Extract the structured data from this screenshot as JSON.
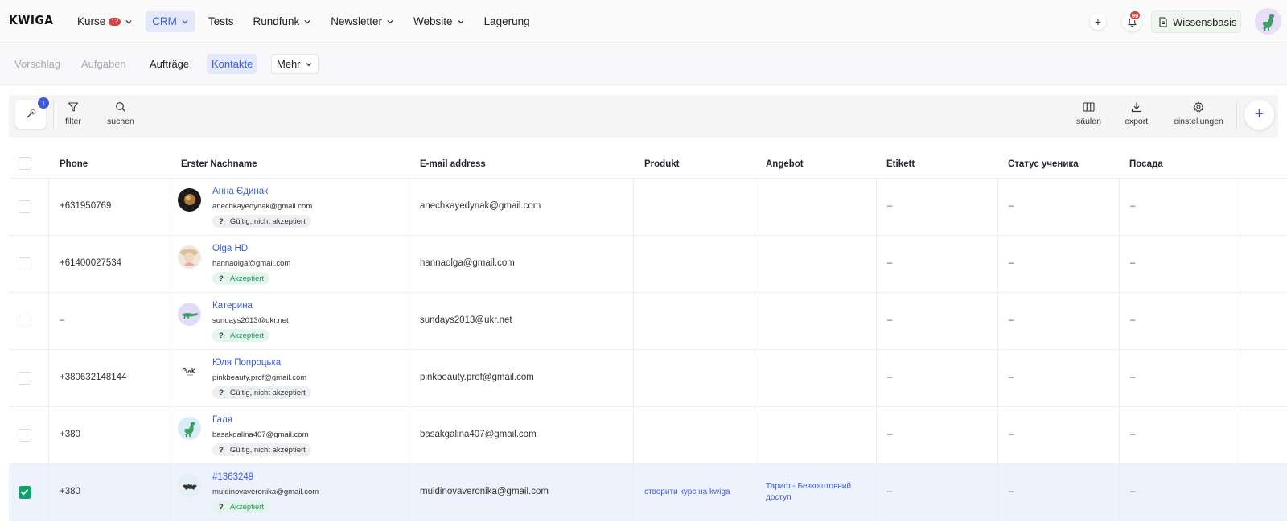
{
  "app": {
    "logo": "KWIGA"
  },
  "nav": {
    "items": [
      {
        "label": "Kurse",
        "badge": "12",
        "dropdown": true,
        "active": false
      },
      {
        "label": "CRM",
        "dropdown": true,
        "active": true
      },
      {
        "label": "Tests",
        "dropdown": false,
        "active": false
      },
      {
        "label": "Rundfunk",
        "dropdown": true,
        "active": false
      },
      {
        "label": "Newsletter",
        "dropdown": true,
        "active": false
      },
      {
        "label": "Website",
        "dropdown": true,
        "active": false
      },
      {
        "label": "Lagerung",
        "dropdown": false,
        "active": false
      }
    ]
  },
  "header_right": {
    "add_icon": "plus-icon",
    "notifications_count": "99",
    "knowledge_base_label": "Wissensbasis"
  },
  "subtabs": {
    "vorschlag": "Vorschlag",
    "aufgaben": "Aufgaben",
    "auftraege": "Aufträge",
    "kontakte": "Kontakte",
    "mehr": "Mehr"
  },
  "toolbar": {
    "magic_badge": "1",
    "filter": "filter",
    "suchen": "suchen",
    "saeulen": "säulen",
    "export": "export",
    "einstellungen": "einstellungen"
  },
  "table": {
    "headers": {
      "phone": "Phone",
      "name": "Erster Nachname",
      "email": "E-mail address",
      "produkt": "Produkt",
      "angebot": "Angebot",
      "etikett": "Etikett",
      "status": "Статус ученика",
      "posada": "Посада"
    },
    "rows": [
      {
        "checked": false,
        "phone": "+631950769",
        "name": "Анна Єдинак",
        "sub_email": "anechkayedynak@gmail.com",
        "status": "Gültig, nicht akzeptiert",
        "status_type": "grey",
        "email": "anechkayedynak@gmail.com",
        "produkt": "",
        "angebot": "",
        "etikett": "–",
        "student_status": "–",
        "posada": "–"
      },
      {
        "checked": false,
        "phone": "+61400027534",
        "name": "Olga HD",
        "sub_email": "hannaolga@gmail.com",
        "status": "Akzeptiert",
        "status_type": "green",
        "email": "hannaolga@gmail.com",
        "produkt": "",
        "angebot": "",
        "etikett": "–",
        "student_status": "–",
        "posada": "–"
      },
      {
        "checked": false,
        "phone": "–",
        "name": "Катерина",
        "sub_email": "sundays2013@ukr.net",
        "status": "Akzeptiert",
        "status_type": "green",
        "email": "sundays2013@ukr.net",
        "produkt": "",
        "angebot": "",
        "etikett": "–",
        "student_status": "–",
        "posada": "–"
      },
      {
        "checked": false,
        "phone": "+380632148144",
        "name": "Юля Попроцька",
        "sub_email": "pinkbeauty.prof@gmail.com",
        "status": "Gültig, nicht akzeptiert",
        "status_type": "grey",
        "email": "pinkbeauty.prof@gmail.com",
        "produkt": "",
        "angebot": "",
        "etikett": "–",
        "student_status": "–",
        "posada": "–"
      },
      {
        "checked": false,
        "phone": "+380",
        "name": "Галя",
        "sub_email": "basakgalina407@gmail.com",
        "status": "Gültig, nicht akzeptiert",
        "status_type": "grey",
        "email": "basakgalina407@gmail.com",
        "produkt": "",
        "angebot": "",
        "etikett": "–",
        "student_status": "–",
        "posada": "–"
      },
      {
        "checked": true,
        "phone": "+380",
        "name": "#1363249",
        "sub_email": "muidinovaveronika@gmail.com",
        "status": "Akzeptiert",
        "status_type": "green",
        "email": "muidinovaveronika@gmail.com",
        "produkt": "створити курс на kwiga",
        "angebot_line1": "Тариф - Безкоштовний",
        "angebot_line2": "доступ",
        "etikett": "–",
        "student_status": "–",
        "posada": "–"
      }
    ],
    "status_prefix": "?"
  },
  "colors": {
    "accent": "#3a5ce0",
    "success": "#10a26a",
    "danger": "#e23b3b"
  }
}
